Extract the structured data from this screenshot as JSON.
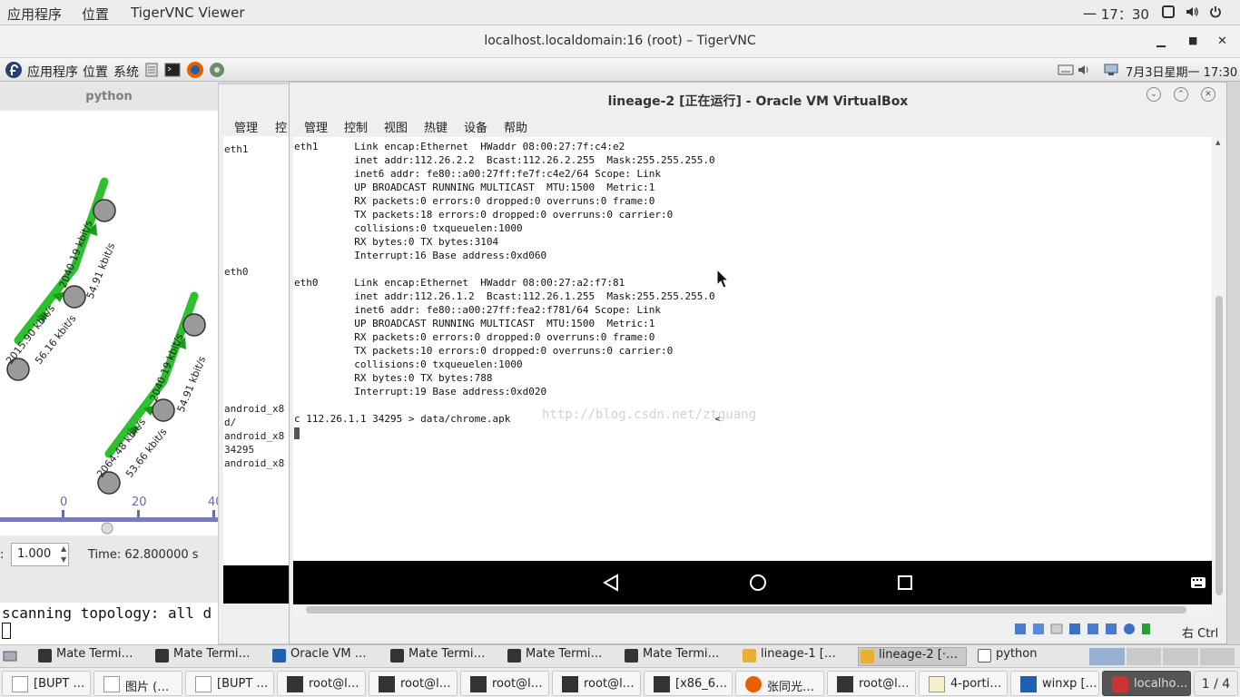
{
  "host_topbar": {
    "apps": "应用程序",
    "places": "位置",
    "window_name": "TigerVNC Viewer",
    "clock": "一 17：30"
  },
  "vnc_window": {
    "title": "localhost.localdomain:16 (root) – TigerVNC"
  },
  "remote_panel": {
    "apps": "应用程序",
    "places": "位置",
    "system": "系统",
    "clock": "7月3日星期一 17:30"
  },
  "python_window": {
    "title": "python",
    "edge_labels": [
      "2015.90 kbit/s",
      "56.16 kbit/s",
      "2040.19 kbit/s",
      "54.91 kbit/s",
      "2064.48 kbit/s",
      "53.66 kbit/s",
      "2040.19 kbit/s",
      "54.91 kbit/s"
    ],
    "ruler_ticks": [
      "0",
      "20",
      "40"
    ],
    "speed_label": ":",
    "speed_value": "1.000",
    "time_text": "Time: 62.800000 s"
  },
  "scan_terminal": {
    "line": "scanning topology: all d"
  },
  "vbox_back": {
    "menu": [
      "管理",
      "控"
    ],
    "lines": [
      "eth1",
      "eth0",
      "android_x8",
      "d/",
      "android_x8",
      "34295",
      "android_x8"
    ]
  },
  "vbox_front": {
    "title": "lineage-2 [正在运行] - Oracle VM VirtualBox",
    "menu": [
      "管理",
      "控制",
      "视图",
      "热键",
      "设备",
      "帮助"
    ],
    "terminal": [
      "eth1      Link encap:Ethernet  HWaddr 08:00:27:7f:c4:e2",
      "          inet addr:112.26.2.2  Bcast:112.26.2.255  Mask:255.255.255.0",
      "          inet6 addr: fe80::a00:27ff:fe7f:c4e2/64 Scope: Link",
      "          UP BROADCAST RUNNING MULTICAST  MTU:1500  Metric:1",
      "          RX packets:0 errors:0 dropped:0 overruns:0 frame:0",
      "          TX packets:18 errors:0 dropped:0 overruns:0 carrier:0",
      "          collisions:0 txqueuelen:1000",
      "          RX bytes:0 TX bytes:3104",
      "          Interrupt:16 Base address:0xd060",
      "",
      "eth0      Link encap:Ethernet  HWaddr 08:00:27:a2:f7:81",
      "          inet addr:112.26.1.2  Bcast:112.26.1.255  Mask:255.255.255.0",
      "          inet6 addr: fe80::a00:27ff:fea2:f781/64 Scope: Link",
      "          UP BROADCAST RUNNING MULTICAST  MTU:1500  Metric:1",
      "          RX packets:0 errors:0 dropped:0 overruns:0 frame:0",
      "          TX packets:10 errors:0 dropped:0 overruns:0 carrier:0",
      "          collisions:0 txqueuelen:1000",
      "          RX bytes:0 TX bytes:788",
      "          Interrupt:19 Base address:0xd020",
      "",
      "c 112.26.1.1 34295 > data/chrome.apk                                  <"
    ],
    "watermark": "http://blog.csdn.net/ztguang",
    "host_key": "右 Ctrl"
  },
  "remote_taskbar": [
    {
      "label": "Mate Termi…",
      "icon": "terminal-icon"
    },
    {
      "label": "Mate Termi…",
      "icon": "terminal-icon"
    },
    {
      "label": "Oracle VM …",
      "icon": "virtualbox-icon"
    },
    {
      "label": "Mate Termi…",
      "icon": "terminal-icon"
    },
    {
      "label": "Mate Termi…",
      "icon": "terminal-icon"
    },
    {
      "label": "Mate Termi…",
      "icon": "terminal-icon"
    },
    {
      "label": "lineage-1 […",
      "icon": "vm-icon"
    },
    {
      "label": "lineage-2 [·…",
      "icon": "vm-icon"
    },
    {
      "label": "python",
      "icon": "window-icon"
    }
  ],
  "host_taskbar": [
    {
      "label": "[BUPT …",
      "icon": "document-icon"
    },
    {
      "label": "图片 (…",
      "icon": "document-icon"
    },
    {
      "label": "[BUPT …",
      "icon": "document-icon"
    },
    {
      "label": "root@l…",
      "icon": "terminal-icon"
    },
    {
      "label": "root@l…",
      "icon": "terminal-icon"
    },
    {
      "label": "root@l…",
      "icon": "terminal-icon"
    },
    {
      "label": "root@l…",
      "icon": "terminal-icon"
    },
    {
      "label": "[x86_6…",
      "icon": "terminal-icon"
    },
    {
      "label": "张同光…",
      "icon": "firefox-icon"
    },
    {
      "label": "root@l…",
      "icon": "terminal-icon"
    },
    {
      "label": "4-porti…",
      "icon": "editor-icon"
    },
    {
      "label": "winxp […",
      "icon": "virtualbox-icon"
    },
    {
      "label": "localho…",
      "icon": "vnc-icon"
    }
  ],
  "workspace": "1 / 4"
}
